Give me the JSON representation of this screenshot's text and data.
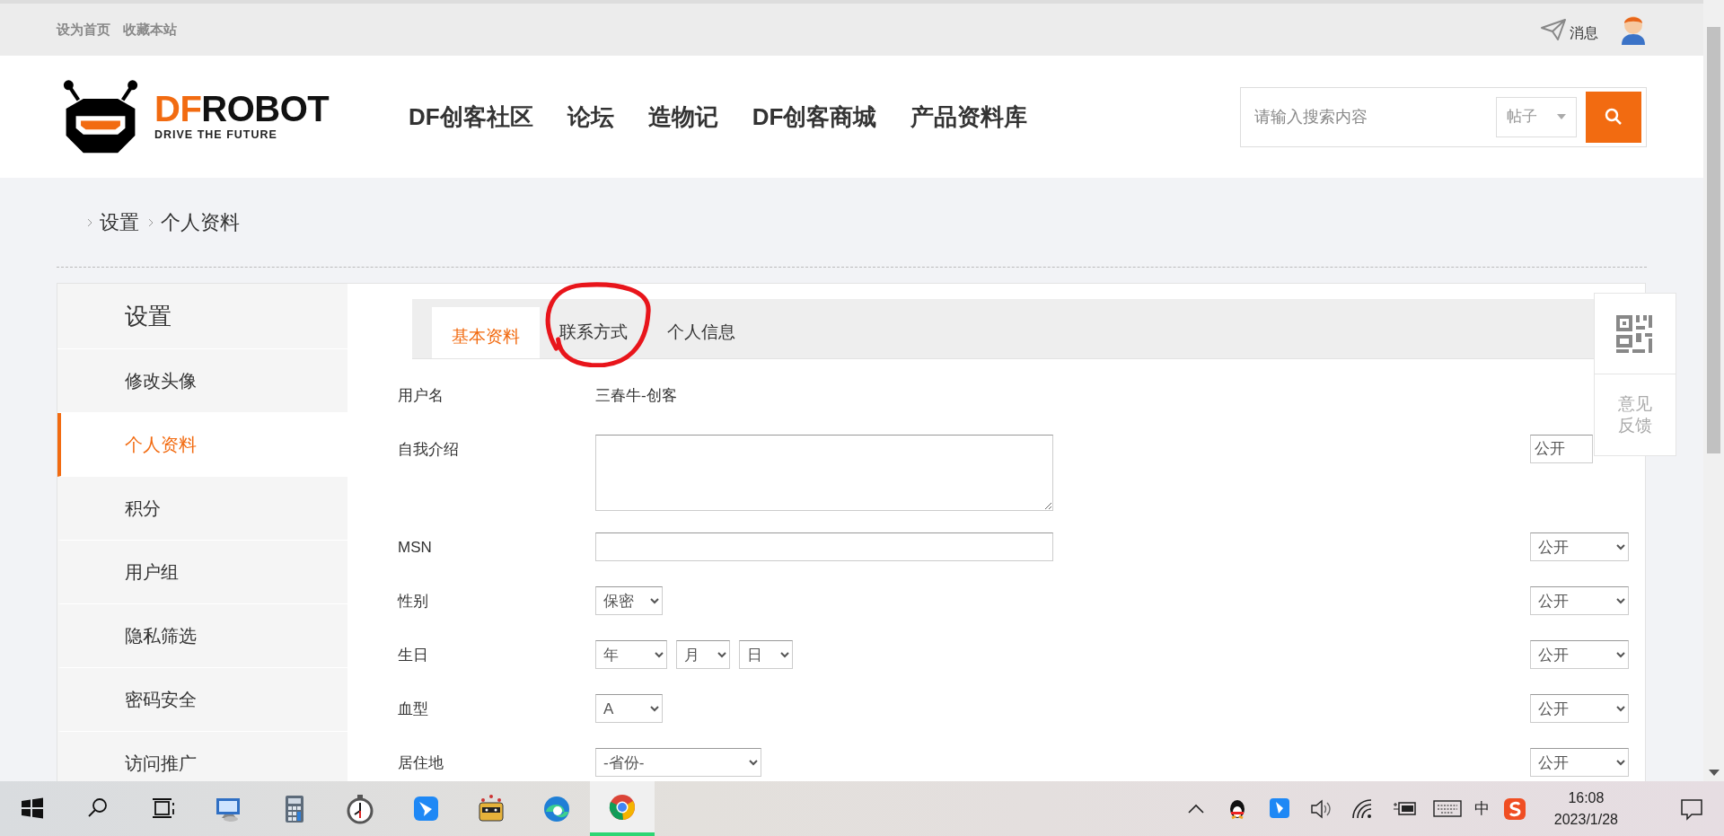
{
  "top_bar": {
    "links": [
      "设为首页",
      "收藏本站"
    ],
    "messages": "消息"
  },
  "logo": {
    "accent": "DF",
    "rest": "ROBOT",
    "tagline": "DRIVE THE FUTURE"
  },
  "nav": [
    "DF创客社区",
    "论坛",
    "造物记",
    "DF创客商城",
    "产品资料库"
  ],
  "search": {
    "placeholder": "请输入搜索内容",
    "scope": "帖子"
  },
  "breadcrumb": [
    "设置",
    "个人资料"
  ],
  "sidebar": {
    "title": "设置",
    "items": [
      {
        "label": "修改头像",
        "selected": false
      },
      {
        "label": "个人资料",
        "selected": true
      },
      {
        "label": "积分",
        "selected": false
      },
      {
        "label": "用户组",
        "selected": false
      },
      {
        "label": "隐私筛选",
        "selected": false
      },
      {
        "label": "密码安全",
        "selected": false
      },
      {
        "label": "访问推广",
        "selected": false
      }
    ]
  },
  "tabs": [
    {
      "label": "基本资料",
      "selected": true,
      "circled": false
    },
    {
      "label": "联系方式",
      "selected": false,
      "circled": true
    },
    {
      "label": "个人信息",
      "selected": false,
      "circled": false
    }
  ],
  "form": {
    "rows": [
      {
        "label": "用户名",
        "kind": "text",
        "value": "三春牛-创客"
      },
      {
        "label": "自我介绍",
        "kind": "textarea",
        "privacy": "公开"
      },
      {
        "label": "MSN",
        "kind": "input",
        "privacy": "公开"
      },
      {
        "label": "性别",
        "kind": "select",
        "selects": [
          "保密"
        ],
        "privacy": "公开"
      },
      {
        "label": "生日",
        "kind": "select",
        "selects": [
          "年",
          "月",
          "日"
        ],
        "privacy": "公开"
      },
      {
        "label": "血型",
        "kind": "select",
        "selects": [
          "A"
        ],
        "privacy": "公开"
      },
      {
        "label": "居住地",
        "kind": "select",
        "selects": [
          "-省份-"
        ],
        "privacy": "公开"
      }
    ]
  },
  "side_widget": {
    "feedback": "意见反馈"
  },
  "taskbar": {
    "apps": [
      {
        "kind": "start",
        "active": false
      },
      {
        "kind": "search",
        "active": false
      },
      {
        "kind": "task-view",
        "active": false
      },
      {
        "kind": "remote-desktop",
        "active": false
      },
      {
        "kind": "calculator",
        "active": false
      },
      {
        "kind": "clock",
        "active": false
      },
      {
        "kind": "messenger",
        "active": false
      },
      {
        "kind": "robot",
        "active": false
      },
      {
        "kind": "edge",
        "active": false
      },
      {
        "kind": "chrome",
        "active": true
      }
    ],
    "tray": {
      "ime": "中",
      "time": "16:08",
      "date": "2023/1/28"
    }
  }
}
